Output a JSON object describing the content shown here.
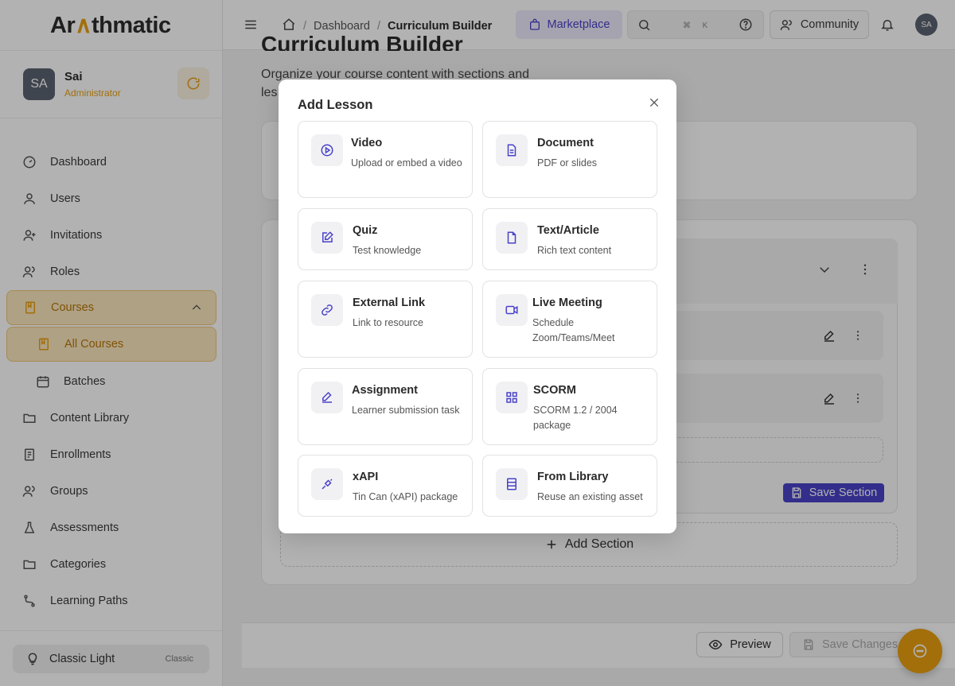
{
  "app": {
    "logo_prefix": "Ar",
    "logo_accent": "∧",
    "logo_suffix": "thmatic",
    "accent_color": "#e8a010",
    "primary_color": "#4a42c8"
  },
  "user": {
    "initials": "SA",
    "name": "Sai",
    "role": "Administrator"
  },
  "sidebar": {
    "items": [
      {
        "label": "Dashboard",
        "icon": "gauge-icon"
      },
      {
        "label": "Users",
        "icon": "user-icon"
      },
      {
        "label": "Invitations",
        "icon": "user-plus-icon"
      },
      {
        "label": "Roles",
        "icon": "users-icon"
      },
      {
        "label": "Courses",
        "icon": "book-icon",
        "active": true,
        "expanded": true
      },
      {
        "label": "All Courses",
        "icon": "book-icon",
        "sub": true,
        "active": true
      },
      {
        "label": "Batches",
        "icon": "calendar-icon",
        "sub": true
      },
      {
        "label": "Content Library",
        "icon": "folder-icon"
      },
      {
        "label": "Enrollments",
        "icon": "clipboard-icon"
      },
      {
        "label": "Groups",
        "icon": "group-icon"
      },
      {
        "label": "Assessments",
        "icon": "flask-icon"
      },
      {
        "label": "Categories",
        "icon": "folder-icon"
      },
      {
        "label": "Learning Paths",
        "icon": "route-icon"
      }
    ],
    "theme": {
      "label": "Classic Light",
      "tag": "Classic"
    }
  },
  "topbar": {
    "breadcrumb": [
      "Dashboard",
      "Curriculum Builder"
    ],
    "marketplace_label": "Marketplace",
    "shortcut_keys": [
      "⌘",
      "K"
    ],
    "community_label": "Community",
    "avatar_initials": "SA"
  },
  "page": {
    "title": "Curriculum Builder",
    "subtitle_line1": "Organize your course content with sections and",
    "subtitle_line2": "les",
    "save_section_label": "Save Section",
    "add_section_label": "Add Section",
    "preview_label": "Preview",
    "save_changes_label": "Save Changes"
  },
  "modal": {
    "title": "Add Lesson",
    "options": [
      {
        "title": "Video",
        "desc": "Upload or embed a video",
        "icon": "play-circle-icon"
      },
      {
        "title": "Document",
        "desc": "PDF or slides",
        "icon": "file-text-icon"
      },
      {
        "title": "Quiz",
        "desc": "Test knowledge",
        "icon": "edit-square-icon"
      },
      {
        "title": "Text/Article",
        "desc": "Rich text content",
        "icon": "file-icon"
      },
      {
        "title": "External Link",
        "desc": "Link to resource",
        "icon": "link-icon"
      },
      {
        "title": "Live Meeting",
        "desc": "Schedule Zoom/Teams/Meet",
        "icon": "video-camera-icon"
      },
      {
        "title": "Assignment",
        "desc": "Learner submission task",
        "icon": "pen-icon"
      },
      {
        "title": "SCORM",
        "desc": "SCORM 1.2 / 2004 package",
        "icon": "grid-icon"
      },
      {
        "title": "xAPI",
        "desc": "Tin Can (xAPI) package",
        "icon": "plug-icon"
      },
      {
        "title": "From Library",
        "desc": "Reuse an existing asset",
        "icon": "library-icon"
      }
    ]
  }
}
